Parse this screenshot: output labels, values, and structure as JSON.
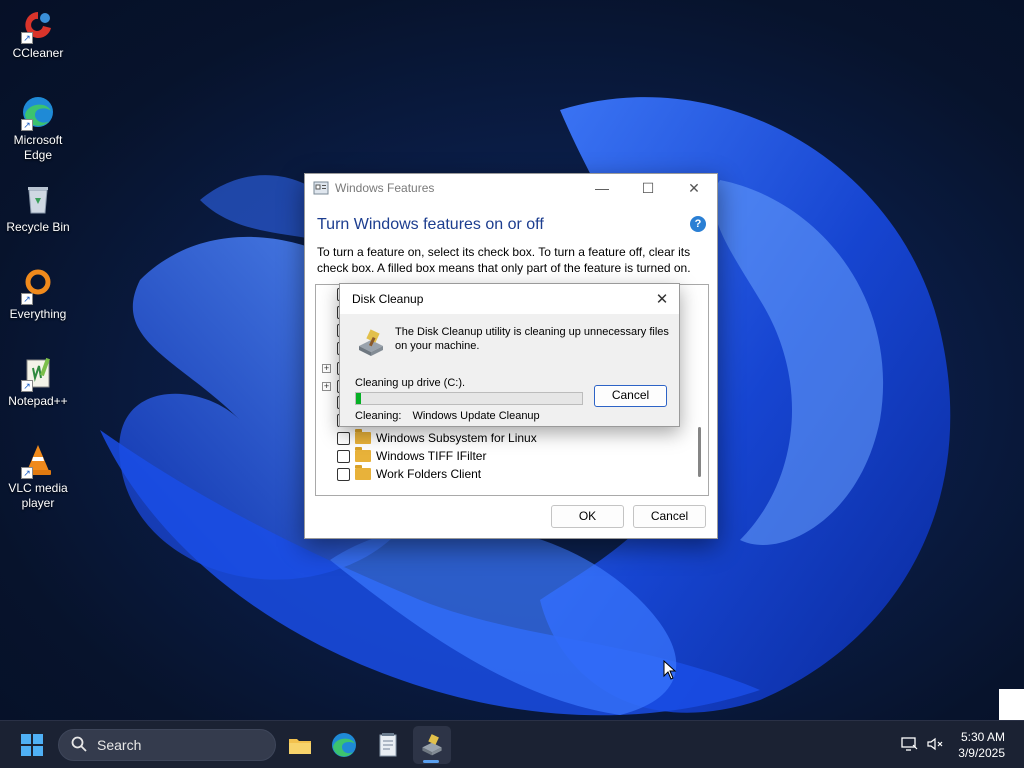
{
  "desktop": {
    "icons": [
      {
        "label": "CCleaner",
        "icon": "ccleaner-icon"
      },
      {
        "label": "Microsoft Edge",
        "icon": "edge-icon"
      },
      {
        "label": "Recycle Bin",
        "icon": "recycle-bin-icon"
      },
      {
        "label": "Everything",
        "icon": "everything-icon"
      },
      {
        "label": "Notepad++",
        "icon": "notepadpp-icon"
      },
      {
        "label": "VLC media player",
        "icon": "vlc-icon"
      }
    ]
  },
  "features_window": {
    "title": "Windows Features",
    "heading": "Turn Windows features on or off",
    "help_label": "?",
    "description": "To turn a feature on, select its check box. To turn a feature off, clear its check box. A filled box means that only part of the feature is turned on.",
    "visible_items": [
      {
        "label": "Windows Subsystem for Linux",
        "checked": false
      },
      {
        "label": "Windows TIFF IFilter",
        "checked": false
      },
      {
        "label": "Work Folders Client",
        "checked": false
      }
    ],
    "ok_label": "OK",
    "cancel_label": "Cancel"
  },
  "disk_cleanup": {
    "title": "Disk Cleanup",
    "message": "The Disk Cleanup utility is cleaning up unnecessary files on your machine.",
    "drive_text": "Cleaning up drive  (C:).",
    "progress_percent": 2,
    "status_label": "Cleaning:",
    "status_value": "Windows Update Cleanup",
    "cancel_label": "Cancel"
  },
  "taskbar": {
    "search_placeholder": "Search",
    "pinned": [
      "start-icon",
      "file-explorer-icon",
      "edge-icon",
      "notepad-icon",
      "disk-cleanup-icon"
    ],
    "active_app": "disk-cleanup-icon",
    "clock_time": "5:30 AM",
    "clock_date": "3/9/2025"
  },
  "colors": {
    "accent": "#2d63c6",
    "heading": "#1c3d8f",
    "progress": "#06b025",
    "taskbar": "#1b2233"
  }
}
